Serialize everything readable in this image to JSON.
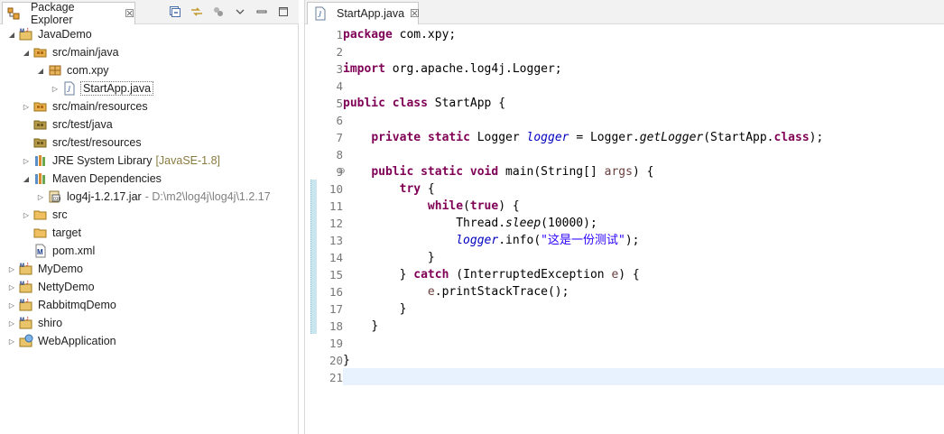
{
  "explorer": {
    "tab_label": "Package Explorer",
    "close_glyph": "☒",
    "toolbar": [
      "collapse-all-icon",
      "link-with-editor-icon",
      "filters-icon",
      "view-menu-icon",
      "minimize-icon",
      "maximize-icon"
    ],
    "tree": [
      {
        "label": "JavaDemo",
        "icon": "maven-project-icon",
        "expanded": true
      },
      {
        "label": "src/main/java",
        "icon": "source-folder-icon",
        "expanded": true
      },
      {
        "label": "com.xpy",
        "icon": "package-icon",
        "expanded": true
      },
      {
        "label": "StartApp.java",
        "icon": "java-file-icon",
        "expanded": false
      },
      {
        "label": "src/main/resources",
        "icon": "source-folder-icon",
        "expanded": false
      },
      {
        "label": "src/test/java",
        "icon": "source-folder-icon",
        "expanded": false
      },
      {
        "label": "src/test/resources",
        "icon": "source-folder-icon",
        "expanded": false
      },
      {
        "label": "JRE System Library",
        "suffix": "[JavaSE-1.8]",
        "icon": "library-icon",
        "expanded": false
      },
      {
        "label": "Maven Dependencies",
        "icon": "library-icon",
        "expanded": true
      },
      {
        "label": "log4j-1.2.17.jar",
        "suffix": "- D:\\m2\\log4j\\log4j\\1.2.17",
        "icon": "jar-icon",
        "expanded": false
      },
      {
        "label": "src",
        "icon": "folder-icon",
        "expanded": false
      },
      {
        "label": "target",
        "icon": "folder-icon"
      },
      {
        "label": "pom.xml",
        "icon": "maven-file-icon"
      },
      {
        "label": "MyDemo",
        "icon": "maven-project-icon",
        "expanded": false
      },
      {
        "label": "NettyDemo",
        "icon": "maven-project-icon",
        "expanded": false
      },
      {
        "label": "RabbitmqDemo",
        "icon": "maven-project-icon",
        "expanded": false
      },
      {
        "label": "shiro",
        "icon": "maven-project-icon",
        "expanded": false
      },
      {
        "label": "WebApplication",
        "icon": "web-project-icon",
        "expanded": false
      }
    ]
  },
  "editor": {
    "tab_label": "StartApp.java",
    "close_glyph": "☒",
    "line_numbers": [
      "1",
      "2",
      "3",
      "4",
      "5",
      "6",
      "7",
      "8",
      "9",
      "10",
      "11",
      "12",
      "13",
      "14",
      "15",
      "16",
      "17",
      "18",
      "19",
      "20",
      "21"
    ],
    "code": {
      "l1_kw": "package",
      "l1_rest": " com.xpy;",
      "l3_kw": "import",
      "l3_rest": " org.apache.log4j.Logger;",
      "l5_kw1": "public",
      "l5_kw2": "class",
      "l5_rest": " StartApp {",
      "l7_kw1": "private",
      "l7_kw2": "static",
      "l7_type": " Logger ",
      "l7_field": "logger",
      "l7_mid": " = Logger.",
      "l7_method": "getLogger",
      "l7_arg": "(StartApp.",
      "l7_kw3": "class",
      "l7_end": ");",
      "l9_kw1": "public",
      "l9_kw2": "static",
      "l9_kw3": "void",
      "l9_sig": " main(String[] ",
      "l9_param": "args",
      "l9_end": ") {",
      "l10_kw": "try",
      "l10_end": " {",
      "l11_kw1": "while",
      "l11_kw2": "true",
      "l11_end": ") {",
      "l12_pre": "Thread.",
      "l12_method": "sleep",
      "l12_end": "(10000);",
      "l13_field": "logger",
      "l13_mid": ".info(",
      "l13_str": "\"这是一份测试\"",
      "l13_end": ");",
      "l14": "}",
      "l15_pre": "} ",
      "l15_kw": "catch",
      "l15_mid": " (InterruptedException ",
      "l15_var": "e",
      "l15_end": ") {",
      "l16_var": "e",
      "l16_end": ".printStackTrace();",
      "l17": "}",
      "l18": "}",
      "l20": "}"
    }
  }
}
